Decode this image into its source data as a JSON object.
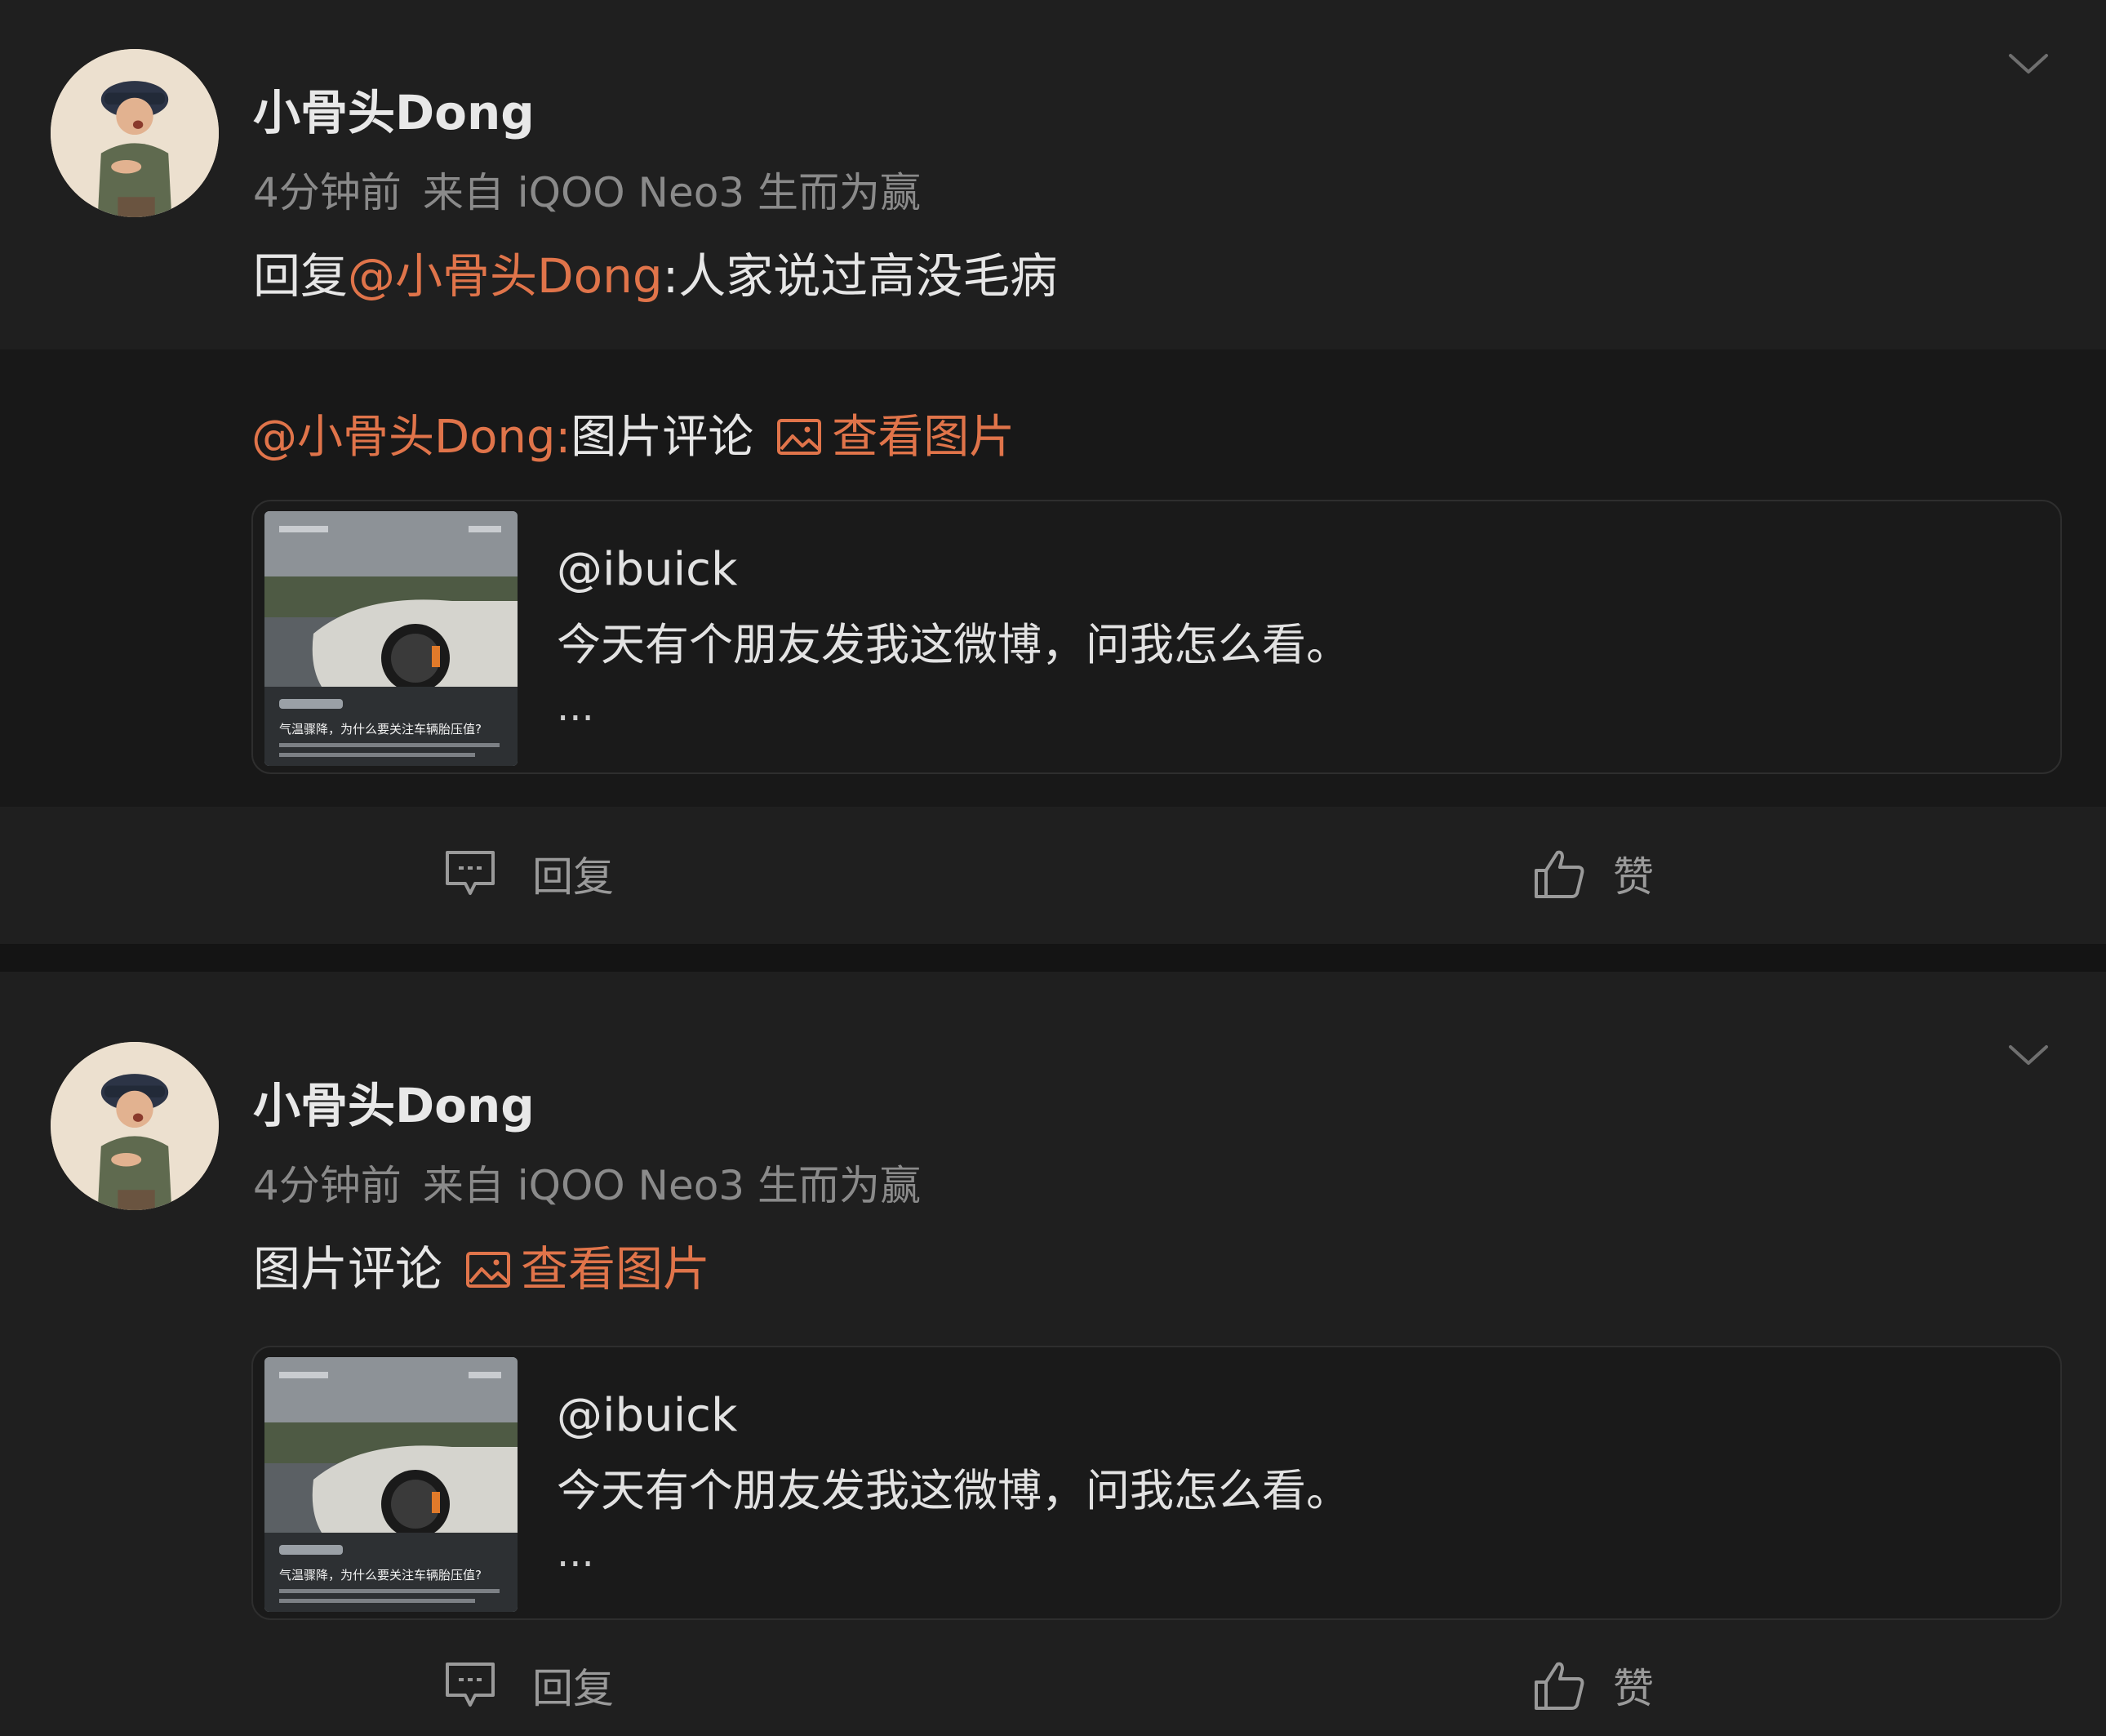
{
  "posts": [
    {
      "username": "小骨头Dong",
      "time": "4分钟前",
      "source": "来自 iQOO Neo3 生而为赢",
      "reply_prefix": "回复",
      "reply_mention": "@小骨头Dong",
      "reply_body": ":人家说过高没毛病",
      "quoted": {
        "mention": "@小骨头Dong:",
        "text": "图片评论",
        "view_image_label": "查看图片"
      },
      "card": {
        "user": "@ibuick",
        "text": "今天有个朋友发我这微博，问我怎么看。",
        "ellipsis": "..."
      },
      "actions": {
        "reply_label": "回复",
        "like_label": "赞"
      }
    },
    {
      "username": "小骨头Dong",
      "time": "4分钟前",
      "source": "来自 iQOO Neo3 生而为赢",
      "comment_text": "图片评论",
      "view_image_label": "查看图片",
      "card": {
        "user": "@ibuick",
        "text": "今天有个朋友发我这微博，问我怎么看。",
        "ellipsis": "..."
      },
      "actions": {
        "reply_label": "回复",
        "like_label": "赞"
      }
    }
  ],
  "thumb_caption": "气温骤降，为什么要关注车辆胎压值?",
  "colors": {
    "background": "#1f1f1f",
    "quote_background": "#181818",
    "accent": "#e0744a",
    "text": "#e6e6e6",
    "meta": "#8a8a8a"
  },
  "icons": [
    "chevron-down-icon",
    "image-icon",
    "comment-icon",
    "thumbs-up-icon"
  ]
}
